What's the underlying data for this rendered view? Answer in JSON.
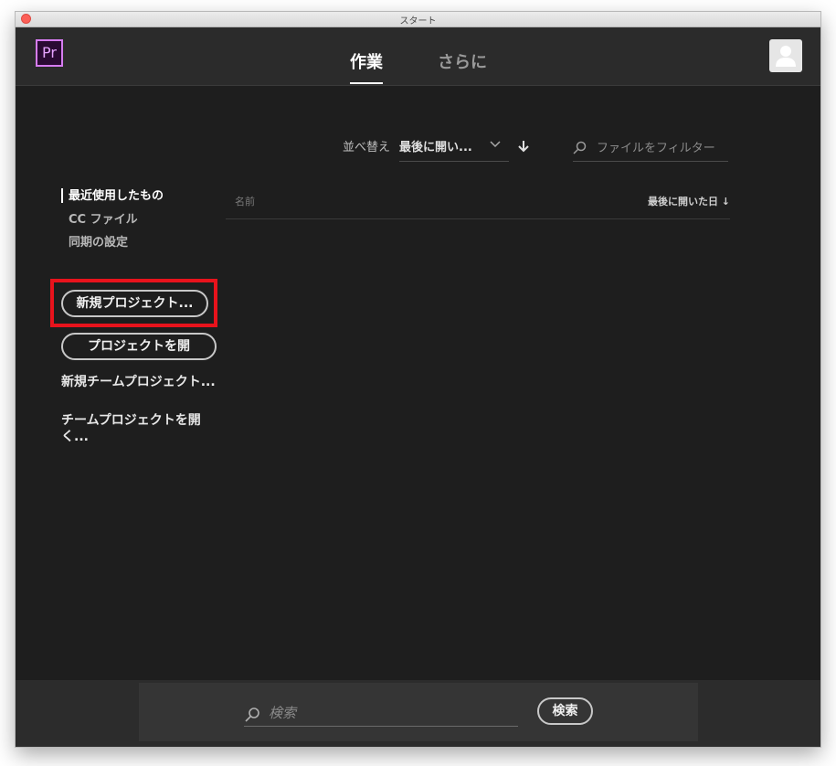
{
  "window": {
    "title": "スタート"
  },
  "app": {
    "logo_text": "Pr"
  },
  "tabs": [
    {
      "label": "作業",
      "active": true
    },
    {
      "label": "さらに",
      "active": false
    }
  ],
  "sort": {
    "label": "並べ替え",
    "value": "最後に開い..."
  },
  "filter": {
    "placeholder": "ファイルをフィルター"
  },
  "nav": {
    "items": [
      {
        "label": "最近使用したもの"
      },
      {
        "label": "CC ファイル"
      },
      {
        "label": "同期の設定"
      }
    ]
  },
  "actions": {
    "new_project": "新規プロジェクト...",
    "open_project": "プロジェクトを開",
    "new_team_project": "新規チームプロジェクト...",
    "open_team_project": "チームプロジェクトを開く..."
  },
  "list": {
    "col_name": "名前",
    "col_date": "最後に開いた日 ↓"
  },
  "search": {
    "placeholder": "検索",
    "button": "検索"
  },
  "colors": {
    "brand": "#d67cf0",
    "highlight": "#e8131c"
  }
}
